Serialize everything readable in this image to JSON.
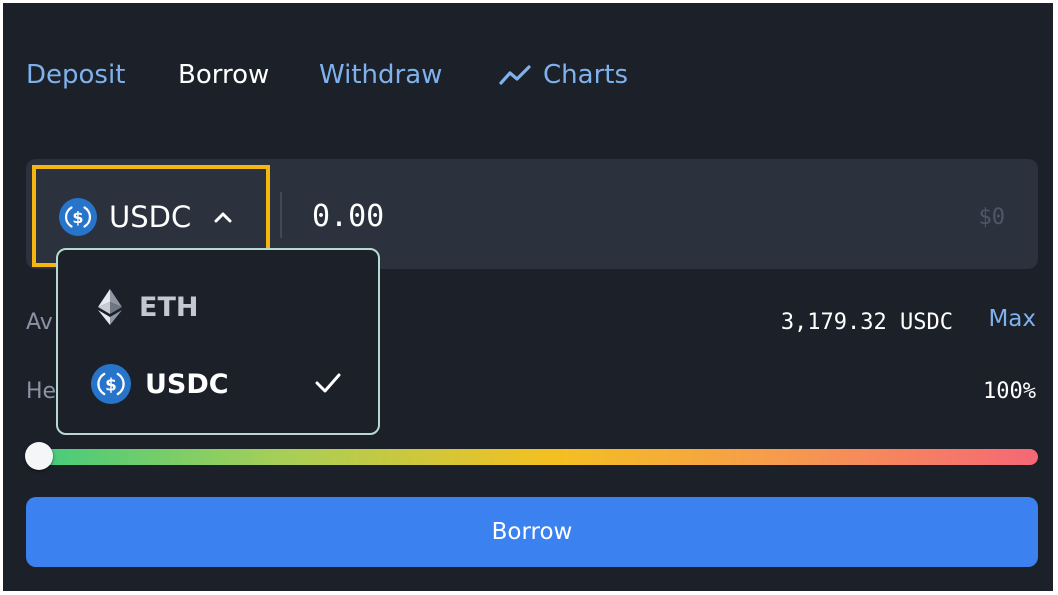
{
  "tabs": {
    "deposit": "Deposit",
    "borrow": "Borrow",
    "withdraw": "Withdraw",
    "charts": "Charts",
    "active": "borrow"
  },
  "token_select": {
    "selected": "USDC",
    "icon": "usdc-icon",
    "expanded": true
  },
  "amount_input": {
    "value": "0.00",
    "usd_value": "$0"
  },
  "available": {
    "label_partial": "Av",
    "value": "3,179.32 USDC",
    "max_label": "Max"
  },
  "health": {
    "label_partial": "He",
    "value": "100%"
  },
  "slider": {
    "level": 0
  },
  "borrow_button": {
    "label": "Borrow"
  },
  "dropdown": {
    "options": [
      {
        "label": "ETH",
        "icon": "ethereum-icon",
        "selected": false
      },
      {
        "label": "USDC",
        "icon": "usdc-icon",
        "selected": true
      }
    ]
  },
  "colors": {
    "background": "#1c2029",
    "input_bg": "#2b313d",
    "accent_link": "#7fb2ec",
    "button": "#3b82f0",
    "highlight": "#f5b611",
    "usdc": "#2775ca"
  }
}
